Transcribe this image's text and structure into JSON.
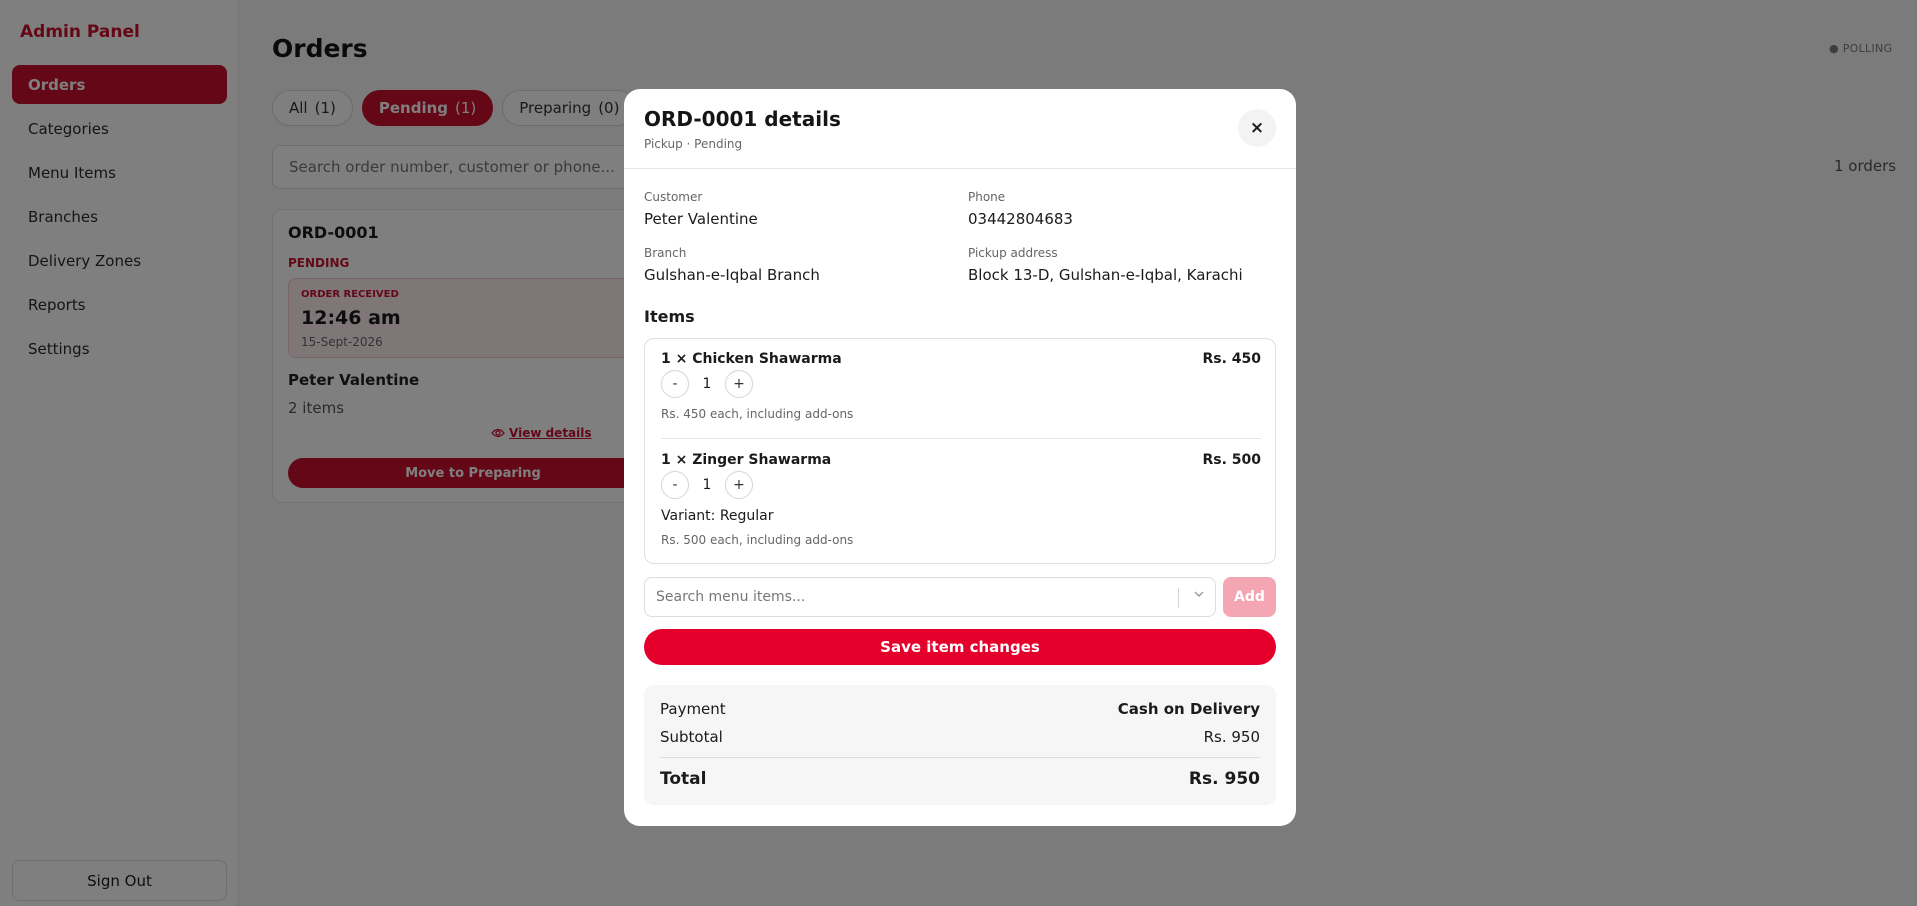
{
  "sidebar": {
    "brand": "Admin Panel",
    "items": [
      {
        "label": "Orders"
      },
      {
        "label": "Categories"
      },
      {
        "label": "Menu Items"
      },
      {
        "label": "Branches"
      },
      {
        "label": "Delivery Zones"
      },
      {
        "label": "Reports"
      },
      {
        "label": "Settings"
      }
    ],
    "active_index": 0,
    "sign_out": "Sign Out"
  },
  "main": {
    "title": "Orders",
    "polling": "● POLLING",
    "tabs": [
      {
        "label": "All",
        "count": "(1)"
      },
      {
        "label": "Pending",
        "count": "(1)"
      },
      {
        "label": "Preparing",
        "count": "(0)"
      }
    ],
    "active_tab": 1,
    "search_placeholder": "Search order number, customer or phone...",
    "orders_count": "1 orders",
    "card": {
      "order_id": "ORD-0001",
      "status": "PENDING",
      "received_label": "ORDER RECEIVED",
      "time": "12:46 am",
      "date": "15-Sept-2026",
      "customer": "Peter Valentine",
      "items_count": "2 items",
      "view_details": "View details",
      "move_button": "Move to Preparing"
    }
  },
  "modal": {
    "title": "ORD-0001 details",
    "subtitle": "Pickup · Pending",
    "close_icon": "×",
    "fields": {
      "customer_label": "Customer",
      "customer": "Peter Valentine",
      "phone_label": "Phone",
      "phone": "03442804683",
      "branch_label": "Branch",
      "branch": "Gulshan-e-Iqbal Branch",
      "address_label": "Pickup address",
      "address": "Block 13-D, Gulshan-e-Iqbal, Karachi"
    },
    "items_heading": "Items",
    "items": [
      {
        "name": "1 × Chicken Shawarma",
        "price": "Rs. 450",
        "qty": "1",
        "variant": "",
        "note": "Rs. 450 each, including add-ons"
      },
      {
        "name": "1 × Zinger Shawarma",
        "price": "Rs. 500",
        "qty": "1",
        "variant": "Variant: Regular",
        "note": "Rs. 500 each, including add-ons"
      }
    ],
    "stepper_minus": "-",
    "stepper_plus": "+",
    "add_search_placeholder": "Search menu items...",
    "add_button": "Add",
    "save_button": "Save item changes",
    "summary": {
      "payment_label": "Payment",
      "payment_value": "Cash on Delivery",
      "subtotal_label": "Subtotal",
      "subtotal_value": "Rs. 950",
      "total_label": "Total",
      "total_value": "Rs. 950"
    }
  },
  "colors": {
    "accent": "#c8102e",
    "save": "#e4002b",
    "add_disabled": "#f4a6b3",
    "overlay": "rgba(0,0,0,0.5)"
  }
}
